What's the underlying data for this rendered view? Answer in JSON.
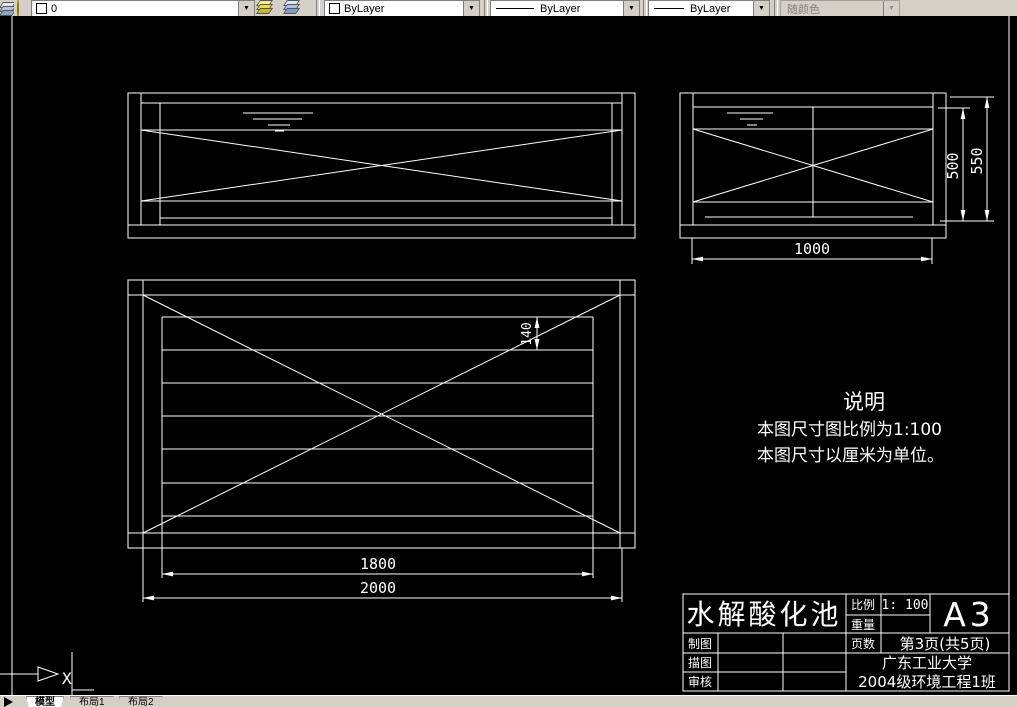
{
  "toolbar": {
    "layer_combo": {
      "layer_name": "0"
    },
    "color_combo": {
      "value": "ByLayer"
    },
    "linetype_combo": {
      "value": "ByLayer"
    },
    "lineweight_combo": {
      "value": "ByLayer"
    },
    "plotstyle_combo": {
      "value": "随颜色"
    }
  },
  "drawing": {
    "ucs_x_label": "X",
    "dims": {
      "d1000": "1000",
      "d500": "500",
      "d550": "550",
      "d140": "140",
      "d1800": "1800",
      "d2000": "2000"
    },
    "notes": {
      "title": "说明",
      "line1": "本图尺寸图比例为1:100",
      "line2": "本图尺寸以厘米为单位。"
    },
    "titleblock": {
      "title": "水解酸化池",
      "scale_label": "比例",
      "scale_value": "1: 100",
      "weight_label": "重量",
      "weight_value": "",
      "pages_label": "页数",
      "pages_value": "第3页(共5页)",
      "sheet_size": "A3",
      "drafter_label": "制图",
      "tracer_label": "描图",
      "checker_label": "审核",
      "school": "广东工业大学",
      "class_name": "2004级环境工程1班"
    }
  },
  "tabs": [
    {
      "label": "模型"
    },
    {
      "label": "布局1"
    },
    {
      "label": "布局2"
    }
  ],
  "colors": {
    "canvas_bg": "#000000",
    "line": "#ffffff",
    "toolbar_bg": "#d4d0c8",
    "disabled_text": "#808080"
  }
}
